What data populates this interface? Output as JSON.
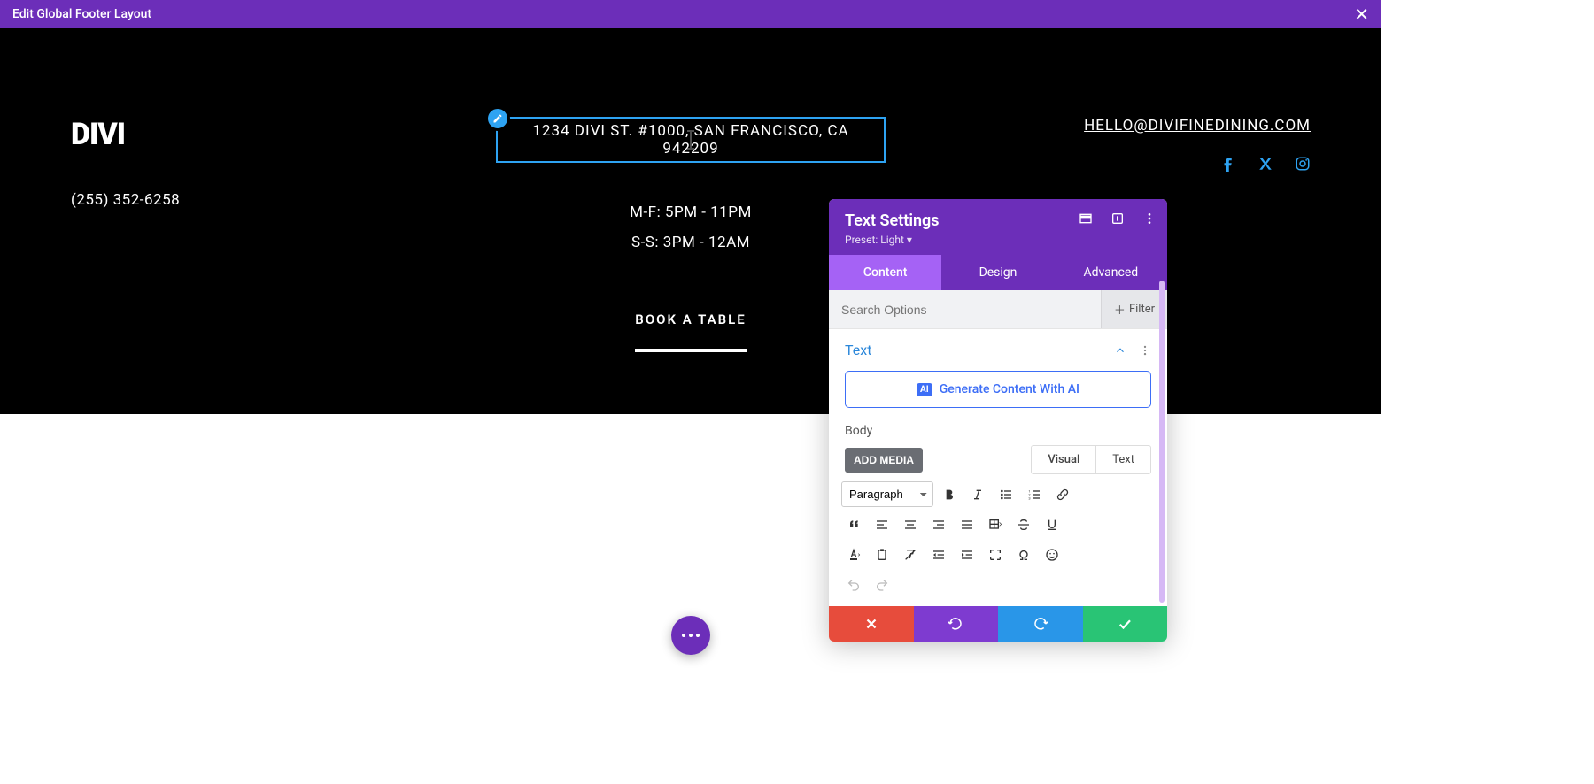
{
  "topbar": {
    "title": "Edit Global Footer Layout"
  },
  "footer": {
    "logo": "DIVI",
    "phone": "(255) 352-6258",
    "address": "1234 DIVI ST. #1000, SAN FRANCISCO, CA 942209",
    "hours1": "M-F: 5PM - 11PM",
    "hours2": "S-S: 3PM - 12AM",
    "book": "BOOK A TABLE",
    "email": "HELLO@DIVIFINEDINING.COM"
  },
  "panel": {
    "title": "Text Settings",
    "preset": "Preset: Light ▾",
    "tabs": {
      "content": "Content",
      "design": "Design",
      "advanced": "Advanced"
    },
    "search_placeholder": "Search Options",
    "filter": "Filter",
    "section_text": "Text",
    "gen_ai": "Generate Content With AI",
    "ai_badge": "AI",
    "body_label": "Body",
    "add_media": "ADD MEDIA",
    "mode_visual": "Visual",
    "mode_text": "Text",
    "format": "Paragraph"
  }
}
